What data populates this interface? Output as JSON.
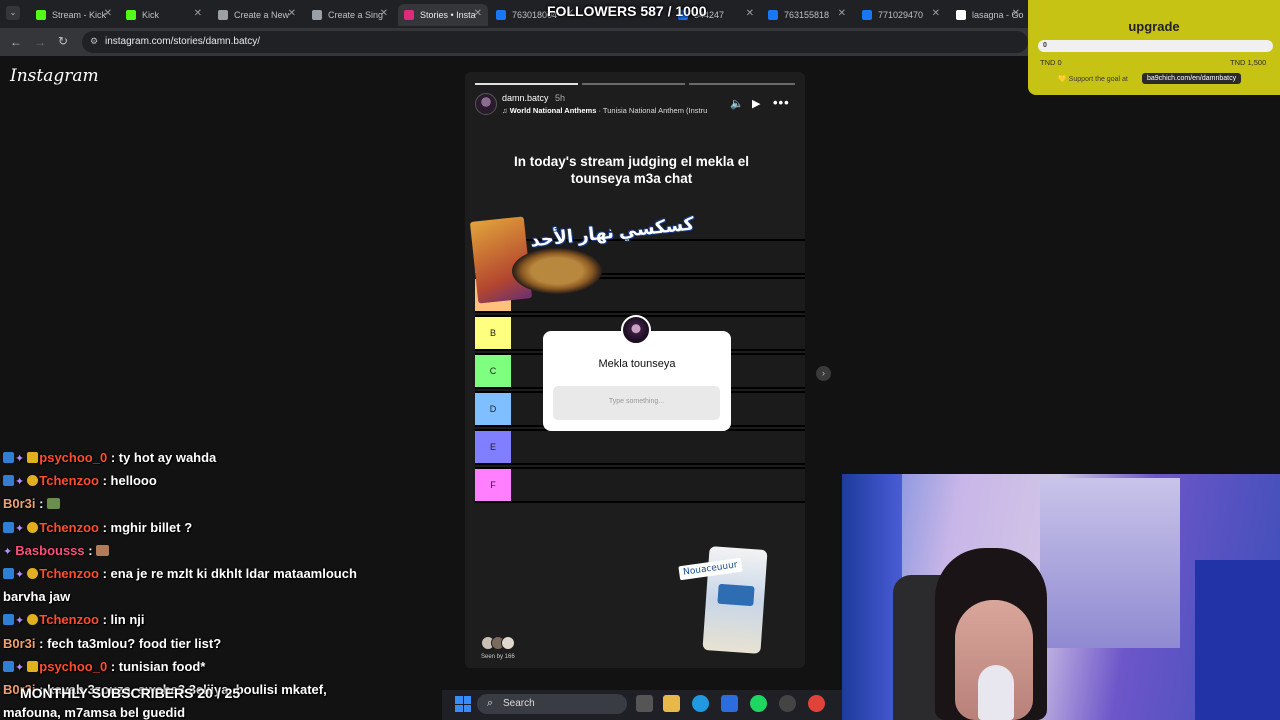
{
  "browser": {
    "tabs": [
      {
        "label": "Stream - Kick",
        "color": "#53fc18"
      },
      {
        "label": "Kick",
        "color": "#53fc18"
      },
      {
        "label": "Create a New",
        "color": "#9aa0a6"
      },
      {
        "label": "Create a Sing",
        "color": "#9aa0a6"
      },
      {
        "label": "Stories • Insta",
        "color": "#dd2a7b"
      },
      {
        "label": "763018004",
        "color": "#1877f2"
      },
      {
        "label": "344247",
        "color": "#1877f2"
      },
      {
        "label": "763155818",
        "color": "#1877f2"
      },
      {
        "label": "771029470",
        "color": "#1877f2"
      },
      {
        "label": "lasagna - Go",
        "color": "#ffffff"
      }
    ],
    "url": "instagram.com/stories/damn.batcy/"
  },
  "overlay": {
    "followers": "FOLLOWERS 587 / 1000",
    "monthly_subs": "MONTHLY SUBSCRIBERS 20 / 25"
  },
  "instagram": {
    "logo": "Instagram"
  },
  "story": {
    "username": "damn.batcy",
    "time": "5h",
    "music_artist": "World National Anthems",
    "music_title": " · Tunisia National Anthem (Instru",
    "heading": "In today's stream judging el mekla el tounseya m3a chat",
    "sticker_text": "كسكسي نهار الأحد",
    "tiers": [
      "",
      "",
      "B",
      "C",
      "D",
      "E",
      "F"
    ],
    "tier_colors": [
      "#ff7f7f",
      "#ffbf7f",
      "#ffff7f",
      "#7fff7f",
      "#7fbfff",
      "#7f7fff",
      "#ff7fff"
    ],
    "question_title": "Mekla tounseya",
    "question_placeholder": "Type something...",
    "rice_label": "Nouaceuuur",
    "seen_by": "Seen by 166"
  },
  "chat": [
    {
      "user": "psychoo_0",
      "color": "#ff4d2e",
      "badges": [
        "blue",
        "purple",
        "crown"
      ],
      "msg": "ty hot ay wahda"
    },
    {
      "user": "Tchenzoo",
      "color": "#ff4d2e",
      "badges": [
        "blue",
        "purple",
        "gold"
      ],
      "msg": "hellooo"
    },
    {
      "user": "B0r3i",
      "color": "#f0a070",
      "badges": [],
      "msg": "",
      "emote": true
    },
    {
      "user": "Tchenzoo",
      "color": "#ff4d2e",
      "badges": [
        "blue",
        "purple",
        "gold"
      ],
      "msg": "mghir billet ?"
    },
    {
      "user": "Basbousss",
      "color": "#ff4d7a",
      "badges": [
        "purple"
      ],
      "msg": "",
      "emote": true
    },
    {
      "user": "Tchenzoo",
      "color": "#ff4d2e",
      "badges": [
        "blue",
        "purple",
        "gold"
      ],
      "msg": "ena je re mzlt ki dkhlt ldar mataamlouch"
    },
    {
      "user": "",
      "color": "#fff",
      "badges": [],
      "msg": "barvha jaw"
    },
    {
      "user": "Tchenzoo",
      "color": "#ff4d2e",
      "badges": [
        "blue",
        "purple",
        "gold"
      ],
      "msg": "lin nji"
    },
    {
      "user": "B0r3i",
      "color": "#f0a070",
      "badges": [],
      "msg": "fech ta3mlou? food tier list?"
    },
    {
      "user": "psychoo_0",
      "color": "#ff4d2e",
      "badges": [
        "blue",
        "purple",
        "crown"
      ],
      "msg": "tunisian food*"
    },
    {
      "user": "B0r3i",
      "color": "#f0a070",
      "badges": [],
      "msg": "kayab 3zouza, swaba3 3eliiya, boulisi mkatef,"
    },
    {
      "user": "",
      "color": "#fff",
      "badges": [],
      "msg": "mafouna, m7amsa bel guedid"
    }
  ],
  "goal": {
    "title": "upgrade",
    "current": "0",
    "min": "TND 0",
    "max": "TND 1,500",
    "progress": 0,
    "support_text": "Support the goal at",
    "link": "ba9chich.com/en/damnbatcy"
  },
  "taskbar": {
    "search_label": "Search"
  }
}
